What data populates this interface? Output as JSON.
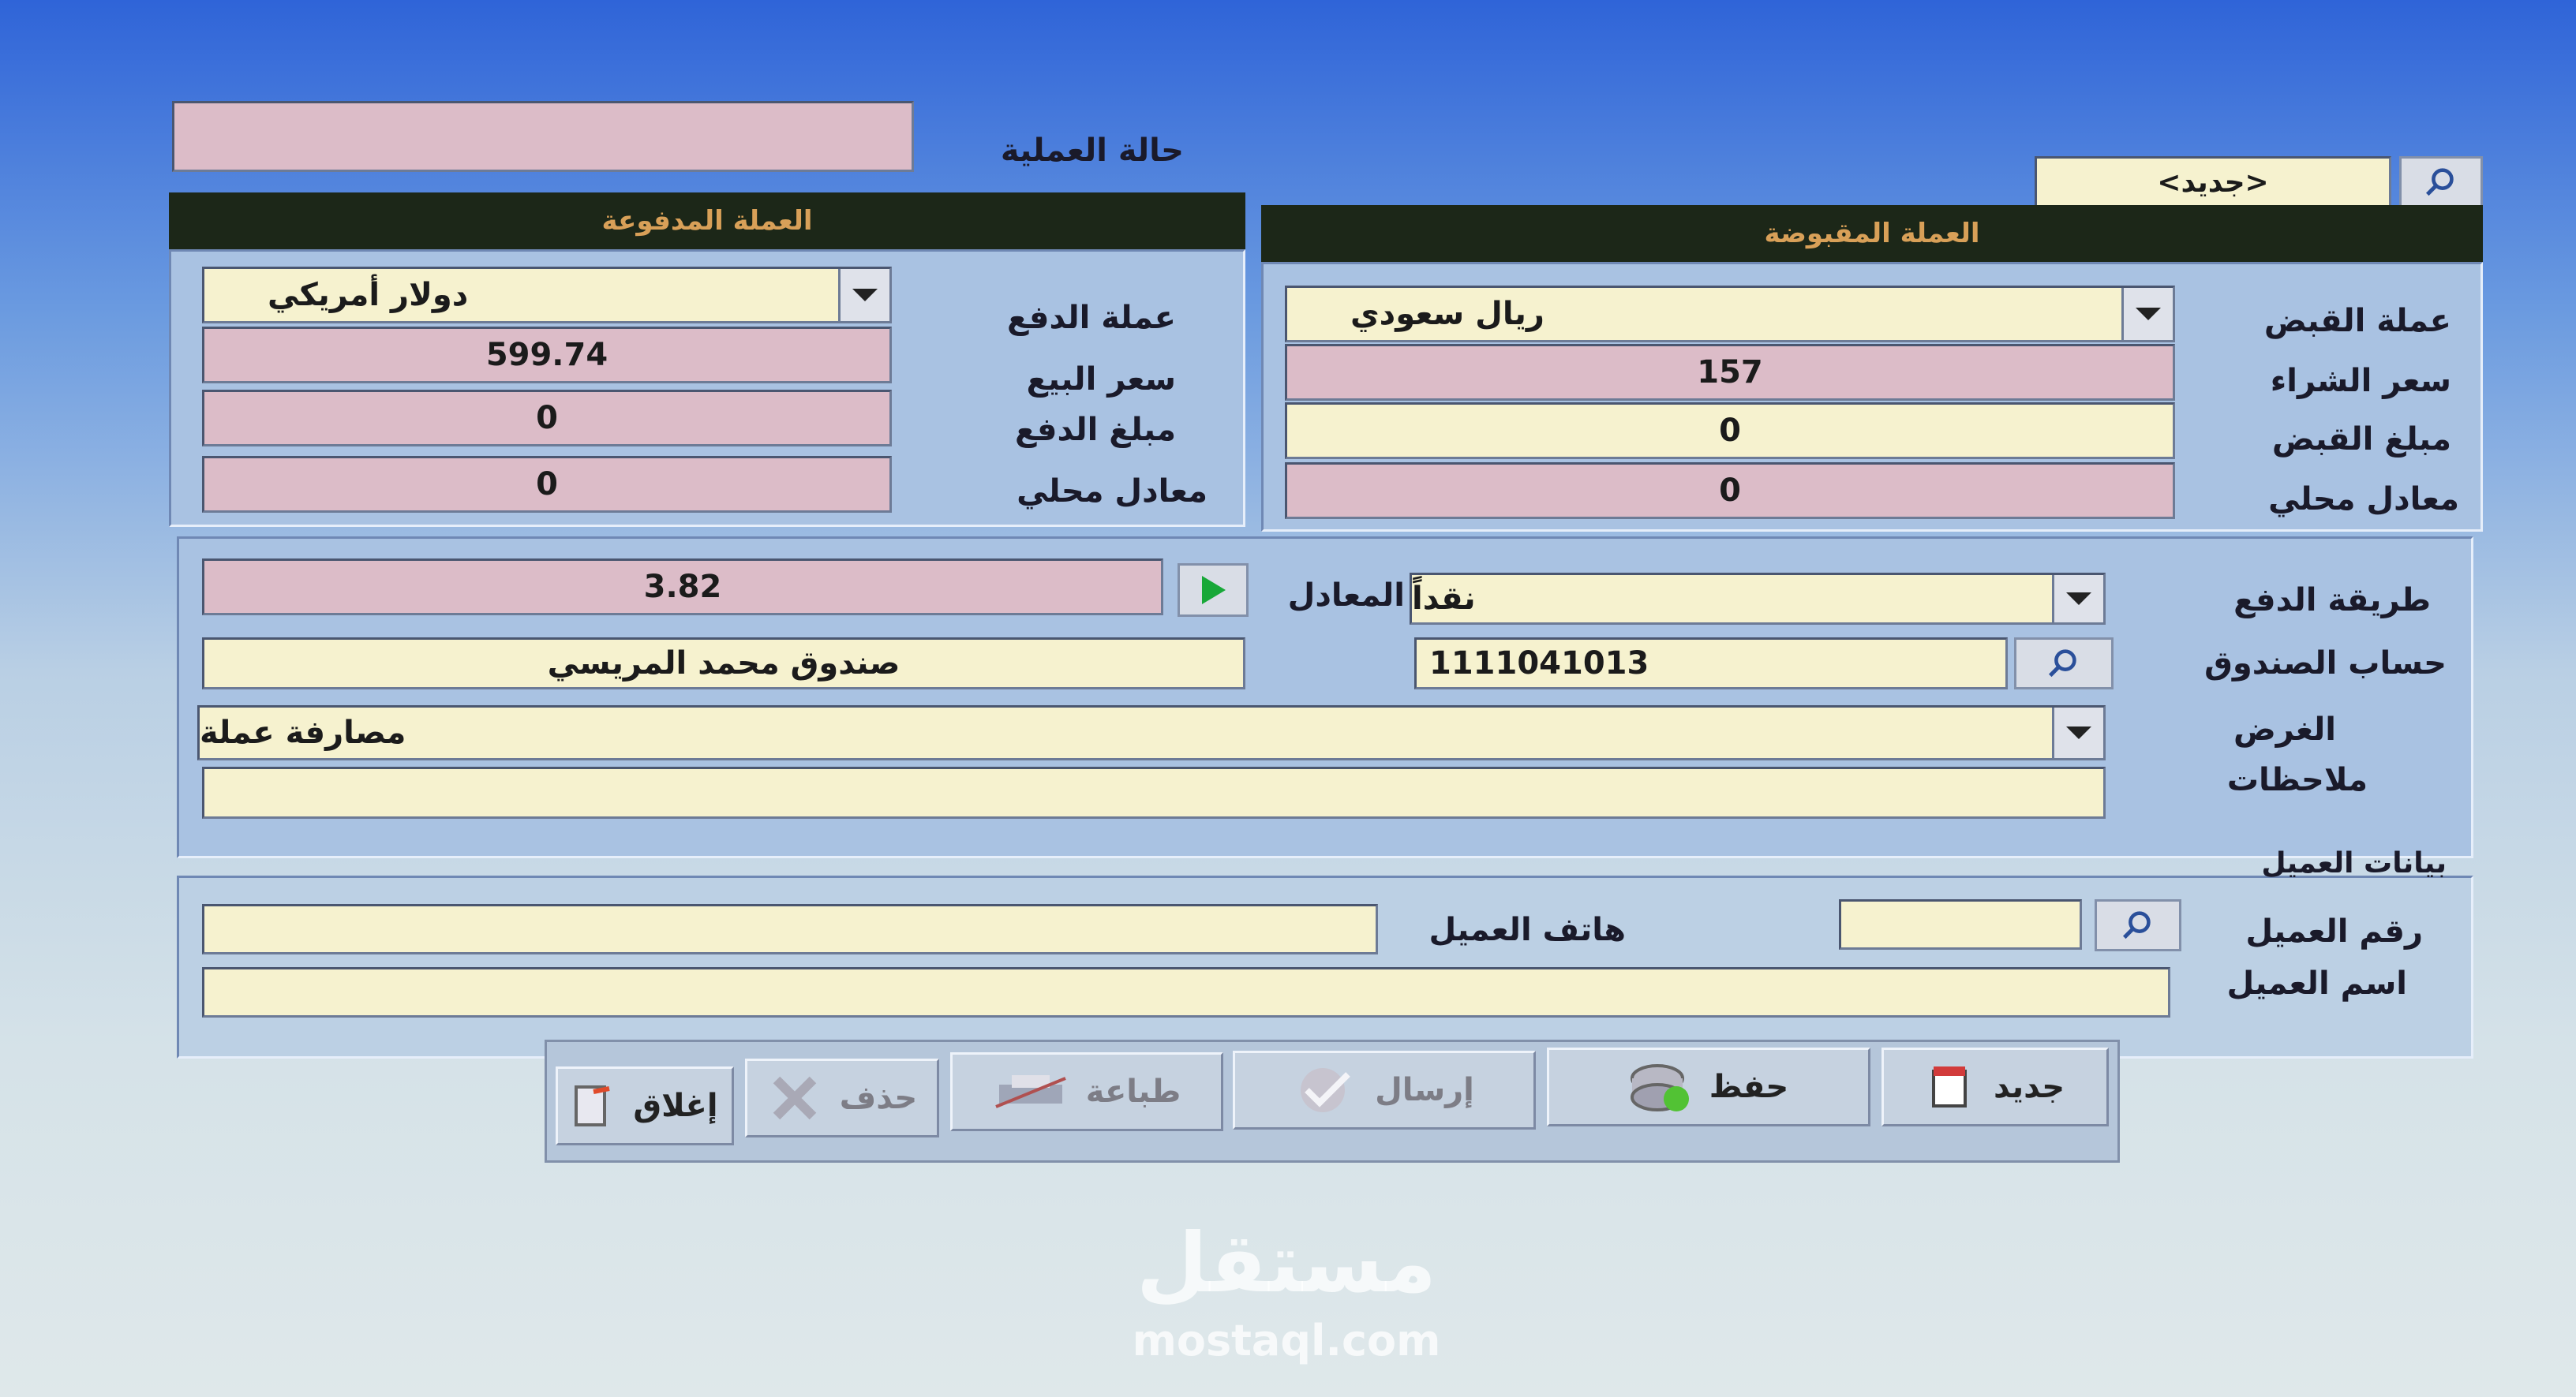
{
  "operation": {
    "status_label": "حالة العملية",
    "status_value": ""
  },
  "search": {
    "value": "<جديد>"
  },
  "received": {
    "header": "العملة المقبوضة",
    "currency_label": "عملة القبض",
    "currency_value": "ريال سعودي",
    "rate_label": "سعر الشراء",
    "rate_value": "157",
    "amount_label": "مبلغ القبض",
    "amount_value": "0",
    "local_label": "معادل محلي",
    "local_value": "0"
  },
  "paid": {
    "header": "العملة المدفوعة",
    "currency_label": "عملة الدفع",
    "currency_value": "دولار أمريكي",
    "rate_label": "سعر البيع",
    "rate_value": "599.74",
    "amount_label": "مبلغ الدفع",
    "amount_value": "0",
    "local_label": "معادل محلي",
    "local_value": "0"
  },
  "payment": {
    "method_label": "طريقة الدفع",
    "method_value": "نقداً",
    "equivalent_label": "المعادل",
    "equivalent_value": "3.82",
    "cashbox_label": "حساب الصندوق",
    "cashbox_value": "1111041013",
    "cashbox_name": "صندوق محمد المريسي",
    "purpose_label": "الغرض",
    "purpose_value": "مصارفة عملة",
    "notes_label": "ملاحظات",
    "notes_value": ""
  },
  "customer": {
    "group_label": "بيانات العميل",
    "number_label": "رقم العميل",
    "number_value": "",
    "phone_label": "هاتف العميل",
    "phone_value": "",
    "name_label": "اسم العميل",
    "name_value": ""
  },
  "toolbar": {
    "new_label": "جديد",
    "save_label": "حفظ",
    "send_label": "إرسال",
    "print_label": "طباعة",
    "delete_label": "حذف",
    "close_label": "إغلاق"
  },
  "watermark": {
    "arabic": "مستقل",
    "latin": "mostaql.com"
  },
  "colors": {
    "header_bg": "#1c2718",
    "header_text": "#d8a058",
    "field_bg": "#f6f2cf",
    "readonly_bg": "#dcbcc8",
    "panel_bg": "#a9c2e2"
  }
}
